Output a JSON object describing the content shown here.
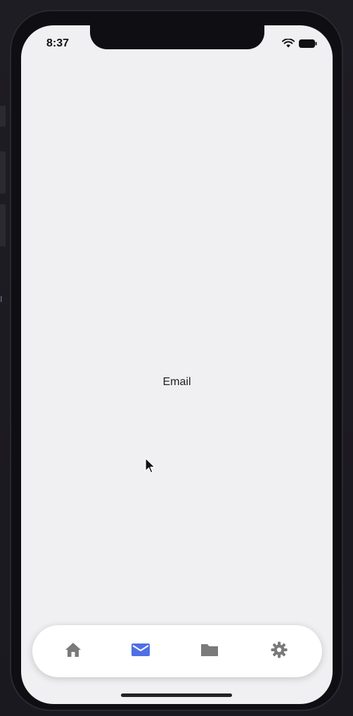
{
  "status_bar": {
    "time": "8:37",
    "icons": [
      "wifi-icon",
      "battery-icon"
    ]
  },
  "main": {
    "title": "Email"
  },
  "tab_bar": {
    "tabs": [
      {
        "icon": "home-icon",
        "active": false
      },
      {
        "icon": "mail-icon",
        "active": true
      },
      {
        "icon": "folder-icon",
        "active": false
      },
      {
        "icon": "gear-icon",
        "active": false
      }
    ]
  },
  "colors": {
    "active": "#4f6fe6",
    "inactive": "#7a7a7a",
    "screen_background": "#f0eff1",
    "frame": "#0f0e13"
  }
}
